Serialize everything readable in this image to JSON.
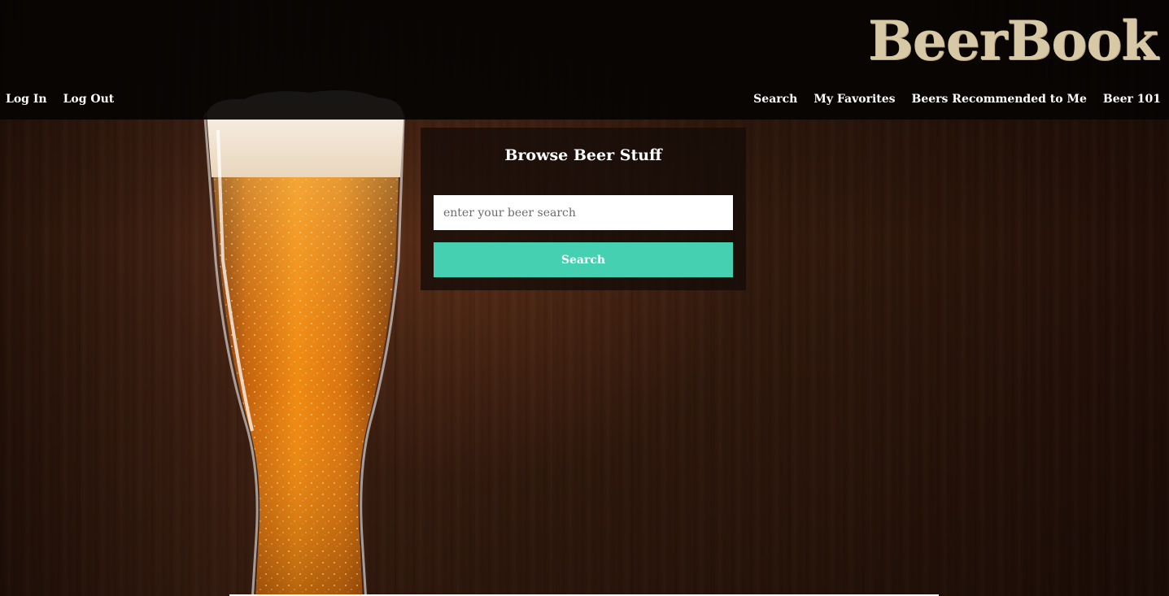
{
  "brand": {
    "name": "BeerBook",
    "color": "#d8c9a6"
  },
  "nav": {
    "left": [
      {
        "label": "Log In"
      },
      {
        "label": "Log Out"
      }
    ],
    "right": [
      {
        "label": "Search"
      },
      {
        "label": "My Favorites"
      },
      {
        "label": "Beers Recommended to Me"
      },
      {
        "label": "Beer 101"
      }
    ]
  },
  "search_panel": {
    "title": "Browse Beer Stuff",
    "input_placeholder": "enter your beer search",
    "input_value": "",
    "button_label": "Search",
    "button_color": "#44d0b1"
  },
  "background": {
    "image": "beer-glass-on-wood",
    "icon": "beer-glass-image"
  }
}
